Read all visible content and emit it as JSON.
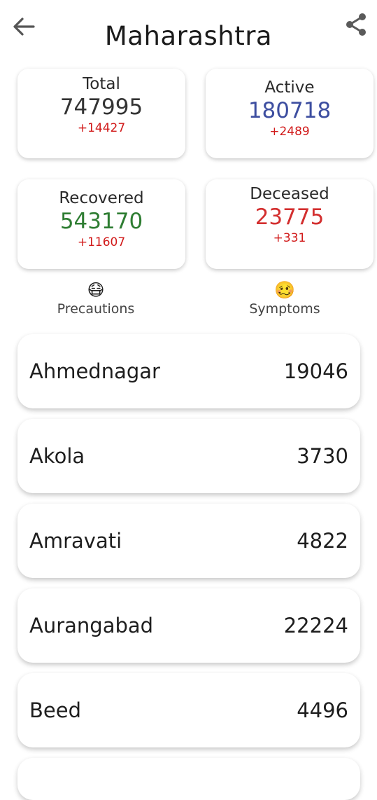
{
  "header": {
    "title": "Maharashtra",
    "back_icon": "arrow-left-icon",
    "share_icon": "share-icon"
  },
  "stats": {
    "total": {
      "label": "Total",
      "value": "747995",
      "delta": "+14427"
    },
    "active": {
      "label": "Active",
      "value": "180718",
      "delta": "+2489"
    },
    "recovered": {
      "label": "Recovered",
      "value": "543170",
      "delta": "+11607"
    },
    "deceased": {
      "label": "Deceased",
      "value": "23775",
      "delta": "+331"
    }
  },
  "colors": {
    "active": "#3d4ea0",
    "recovered": "#2e7d32",
    "deceased": "#d32f2f",
    "delta": "#d11a1a"
  },
  "links": {
    "precautions": {
      "icon": "face-mask-emoji",
      "emoji": "😷",
      "label": "Precautions"
    },
    "symptoms": {
      "icon": "woozy-face-emoji",
      "emoji": "🥴",
      "label": "Symptoms"
    }
  },
  "districts": [
    {
      "name": "Ahmednagar",
      "count": "19046"
    },
    {
      "name": "Akola",
      "count": "3730"
    },
    {
      "name": "Amravati",
      "count": "4822"
    },
    {
      "name": "Aurangabad",
      "count": "22224"
    },
    {
      "name": "Beed",
      "count": "4496"
    }
  ]
}
